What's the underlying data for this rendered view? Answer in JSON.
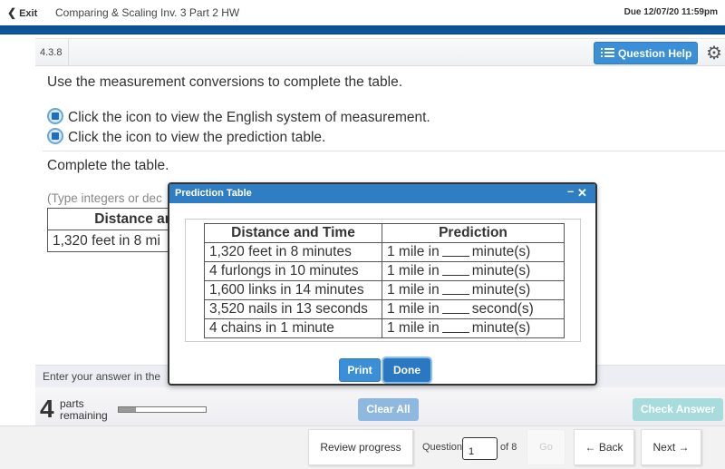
{
  "topbar": {
    "exit_label": "Exit",
    "assignment_title": "Comparing & Scaling Inv. 3 Part 2 HW",
    "due": "Due 12/07/20 11:59pm"
  },
  "question_header": {
    "number": "4.3.8",
    "help_label": "Question Help"
  },
  "question": {
    "prompt": "Use the measurement conversions to complete the table.",
    "links": [
      {
        "icon": "info-square-icon",
        "label": "Click the icon to view the English system of measurement."
      },
      {
        "icon": "info-square-icon",
        "label": "Click the icon to view the prediction table."
      }
    ],
    "instruction": "Complete the table.",
    "hint": "(Type integers or dec",
    "table_header": "Distance and",
    "table_first_cell": "1,320 feet in 8 mi"
  },
  "modal": {
    "title": "Prediction Table",
    "minimize_symbol": "–",
    "close_symbol": "✕",
    "headers": [
      "Distance and Time",
      "Prediction"
    ],
    "rows": [
      {
        "distance_time": "1,320 feet in 8 minutes",
        "prefix": "1 mile in",
        "unit": "minute(s)"
      },
      {
        "distance_time": "4 furlongs in 10 minutes",
        "prefix": "1 mile in",
        "unit": "minute(s)"
      },
      {
        "distance_time": "1,600 links in 14 minutes",
        "prefix": "1 mile in",
        "unit": "minute(s)"
      },
      {
        "distance_time": "3,520 nails in 13 seconds",
        "prefix": "1 mile in",
        "unit": "second(s)"
      },
      {
        "distance_time": "4 chains in 1 minute",
        "prefix": "1 mile in",
        "unit": "minute(s)"
      }
    ],
    "print_label": "Print",
    "done_label": "Done"
  },
  "answer_strip": {
    "text": "Enter your answer in the"
  },
  "parts": {
    "count": "4",
    "label_line1": "parts",
    "label_line2": "remaining",
    "progress_fraction": 0.2
  },
  "actions": {
    "clear_all": "Clear All",
    "check_answer": "Check Answer"
  },
  "bottom_nav": {
    "review_progress": "Review progress",
    "question_label": "Question",
    "question_value": "1",
    "of_total": "of 8",
    "go": "Go",
    "back": "Back",
    "next": "Next"
  },
  "colors": {
    "brand_bar": "#0d5a9e",
    "button_blue": "#3a8fd6",
    "modal_title": "#2f7ec4",
    "check_answer_disabled": "#a8dcdc",
    "clear_all_disabled": "#8fb8e0"
  }
}
